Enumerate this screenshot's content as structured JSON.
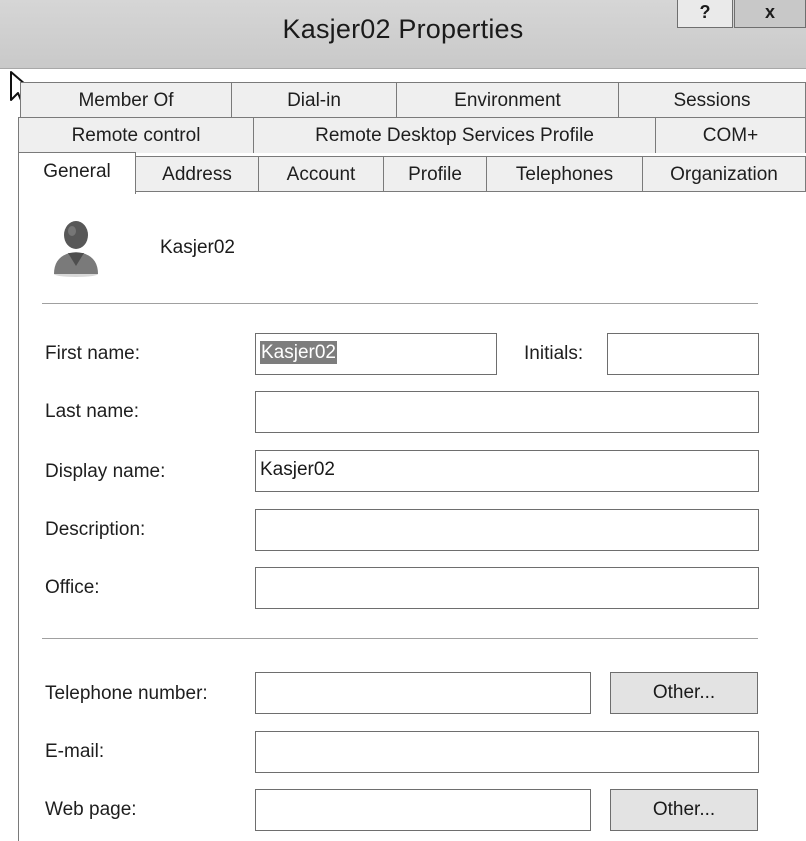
{
  "window": {
    "title": "Kasjer02 Properties",
    "help_label": "?",
    "close_label": "x"
  },
  "tabs": {
    "row1": [
      "Member Of",
      "Dial-in",
      "Environment",
      "Sessions"
    ],
    "row2": [
      "Remote control",
      "Remote Desktop Services Profile",
      "COM+"
    ],
    "row3": [
      "General",
      "Address",
      "Account",
      "Profile",
      "Telephones",
      "Organization"
    ],
    "active": "General"
  },
  "general": {
    "user_display": "Kasjer02",
    "first_name_label": "First name:",
    "first_name_value": "Kasjer02",
    "initials_label": "Initials:",
    "initials_value": "",
    "last_name_label": "Last name:",
    "last_name_value": "",
    "display_name_label": "Display name:",
    "display_name_value": "Kasjer02",
    "description_label": "Description:",
    "description_value": "",
    "office_label": "Office:",
    "office_value": "",
    "telephone_label": "Telephone number:",
    "telephone_value": "",
    "other_label": "Other...",
    "email_label": "E-mail:",
    "email_value": "",
    "web_page_label": "Web page:",
    "web_page_value": ""
  }
}
